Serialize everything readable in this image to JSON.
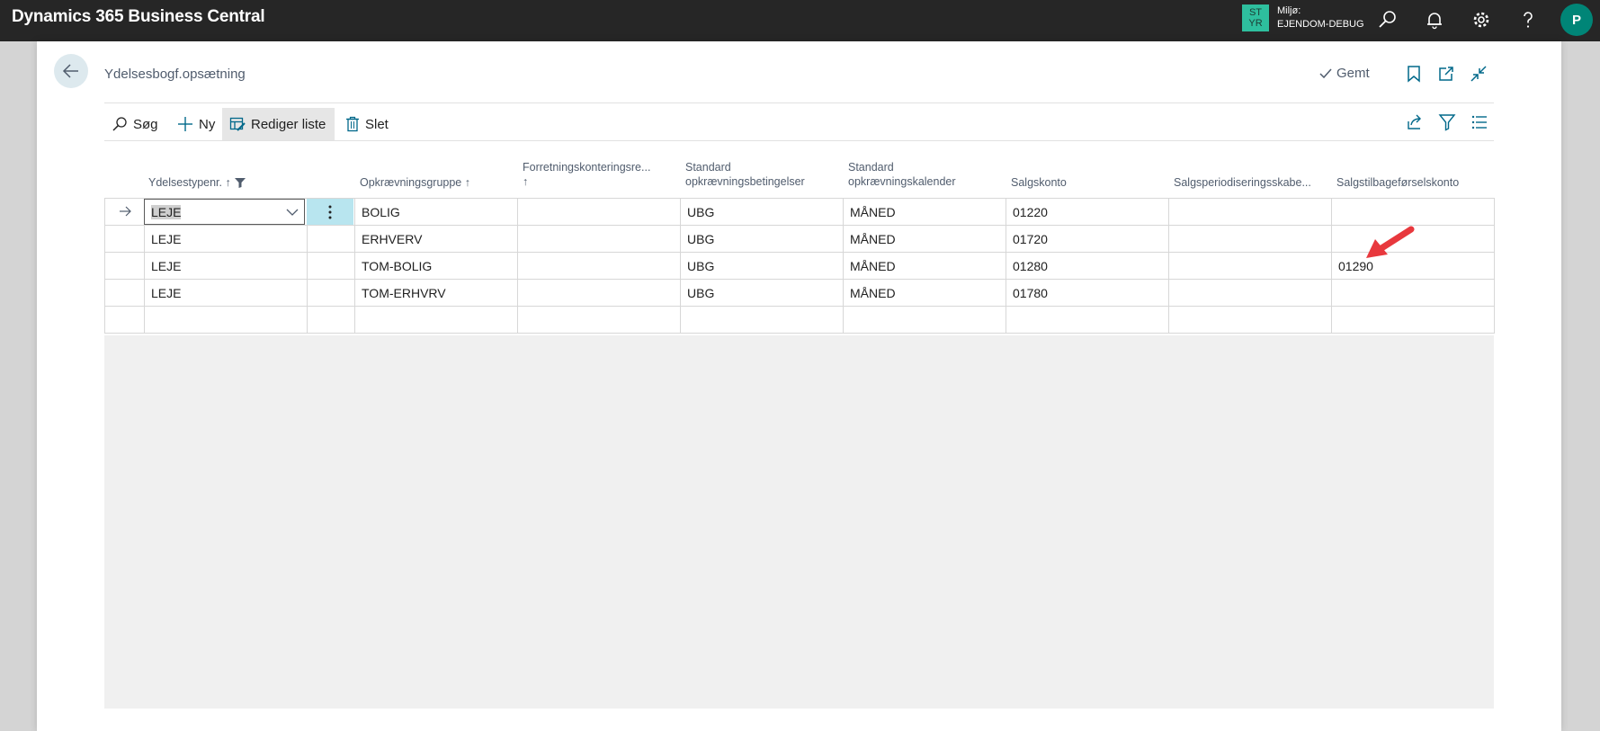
{
  "app": {
    "title": "Dynamics 365 Business Central",
    "env_badge_line1": "ST",
    "env_badge_line2": "YR",
    "env_label": "Miljø:",
    "env_name": "EJENDOM-DEBUG",
    "avatar_initial": "P",
    "accent_color": "#008577"
  },
  "page": {
    "title": "Ydelsesbogf.opsætning",
    "saved_status": "Gemt"
  },
  "actions": [
    {
      "label": "Søg",
      "icon": "search-icon"
    },
    {
      "label": "Ny",
      "icon": "plus-icon"
    },
    {
      "label": "Rediger liste",
      "icon": "edit-list-icon"
    },
    {
      "label": "Slet",
      "icon": "trash-icon"
    }
  ],
  "columns": [
    {
      "label": "Ydelsestypenr. ↑",
      "line2": ""
    },
    {
      "label": "Opkrævningsgruppe ↑",
      "line2": ""
    },
    {
      "label": "Forretningskonteringsre...",
      "line2": "↑"
    },
    {
      "label": "Standard",
      "line2": "opkrævningsbetingelser"
    },
    {
      "label": "Standard",
      "line2": "opkrævningskalender"
    },
    {
      "label": "Salgskonto",
      "line2": ""
    },
    {
      "label": "Salgsperiodiseringsskabe...",
      "line2": ""
    },
    {
      "label": "Salgstilbageførselskonto",
      "line2": ""
    }
  ],
  "rows": [
    {
      "ydelsestype": "LEJE",
      "gruppe": "BOLIG",
      "forretning": "",
      "betingelser": "UBG",
      "kalender": "MÅNED",
      "salgskonto": "01220",
      "periodisering": "",
      "tilbagefoersel": ""
    },
    {
      "ydelsestype": "LEJE",
      "gruppe": "ERHVERV",
      "forretning": "",
      "betingelser": "UBG",
      "kalender": "MÅNED",
      "salgskonto": "01720",
      "periodisering": "",
      "tilbagefoersel": ""
    },
    {
      "ydelsestype": "LEJE",
      "gruppe": "TOM-BOLIG",
      "forretning": "",
      "betingelser": "UBG",
      "kalender": "MÅNED",
      "salgskonto": "01280",
      "periodisering": "",
      "tilbagefoersel": "01290"
    },
    {
      "ydelsestype": "LEJE",
      "gruppe": "TOM-ERHVRV",
      "forretning": "",
      "betingelser": "UBG",
      "kalender": "MÅNED",
      "salgskonto": "01780",
      "periodisering": "",
      "tilbagefoersel": ""
    }
  ]
}
